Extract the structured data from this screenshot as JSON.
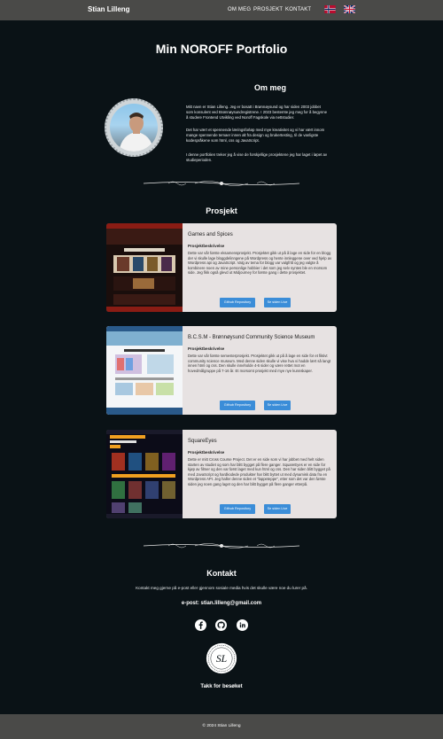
{
  "header": {
    "brand": "Stian Lilleng",
    "nav": [
      "OM MEG",
      "PROSJEKT",
      "KONTAKT"
    ],
    "flags": [
      "norway-flag-icon",
      "uk-flag-icon"
    ]
  },
  "page_title": "Min NOROFF Portfolio",
  "about": {
    "title": "Om meg",
    "paragraphs": [
      "Mitt navn er Stian Lilleng. Jeg er bosatt i Brønnøysund og har siden 2003 jobbet som konsulent ved Brønnøysundregistrene. I 2023 bestemte jeg meg for å begynne å studere Frontend Utvikling ved Noroff Fagskole via nettstudier.",
      "Det har vært et spennende læringsforløp med mye kreativitet og vi har vært innom mange spennende temaer innen alt fra design og brukertesting, til de vanligste kodespråkene som html, css og JavaScript.",
      "I denne portfolien treker jeg å vise de forskjellige prosjektene jeg har laget i løpet av studieperioden."
    ]
  },
  "projects": {
    "title": "Prosjekt",
    "items": [
      {
        "title": "Games and Spices",
        "subtitle": "Prosjektbeskrivelse",
        "description": "Dette var vår første eksamensprosjekt. Prosjektet gikk ut på å lage en side for en blogg der vi skulle lage bloggdelinngene på Wordpress og hente innleggene over ved hjelp av Wordpress api og JavaScript. Valg av tema for blogg var valgfritt og jeg valgte å kombinere noen av mine personlige hobbier i det som jeg selv syntes ble en morsom side. Jeg fikk også glevd ut Midjourney for første gang i dette prosjektet.",
        "github": "Github Repository",
        "live": "Se siden Live"
      },
      {
        "title": "B.C.S.M - Brønnøysund Community Science Museum",
        "subtitle": "Prosjektbeskrivelse",
        "description": "Dette var vår første semesterprosjekt. Prosjektet gikk ut på å lage en side for et fiktivt community science museum. Med denne siden skulle vi vise hva vi hadde lært så langt innen html og css. Den skulle inneholde 4-6 sider og være rettet mot en hovedmålgruppe på 7-16 år. Et morsomt prosjekt med mye nye kunnskaper.",
        "github": "Github Repository",
        "live": "Se siden Live"
      },
      {
        "title": "SquareEyes",
        "subtitle": "Prosjektbeskrivelse",
        "description": "Dette er mitt Cross Course Project. Det er en side som vi har jobbet med helt siden starten av studiet og som har blitt bygget på flere ganger. SquareEyes er en side for kjøp av filmer og den var først laget med kun html og css. Den har siden blitt bygget på med JavaScript og hardkodede produkter har blitt byttet ut med dynamisk data fra en Wordpress API. Jeg haller denne siden et \"lappeteppe\", etter som det var den første siden jeg noen gang laget og den har blitt bygget på flere ganger etterpå.",
        "github": "Github Repository",
        "live": "Se siden Live"
      }
    ]
  },
  "contact": {
    "title": "Kontakt",
    "text": "Kontakt meg gjerne på e-post eller gjennom sosiale media hvis det skulle være noe du lurer på.",
    "email": "e-post: stian.lilleng@gmail.com",
    "socials": [
      "facebook-icon",
      "github-icon",
      "linkedin-icon"
    ],
    "logo_initials": "SL",
    "thanks": "Takk for besøket"
  },
  "footer": {
    "copyright": "© 2024 Stian Lilleng"
  },
  "colors": {
    "background": "#0a1216",
    "header_footer": "#4a4a48",
    "card": "#e7e2e2",
    "button": "#3b8dd8"
  }
}
